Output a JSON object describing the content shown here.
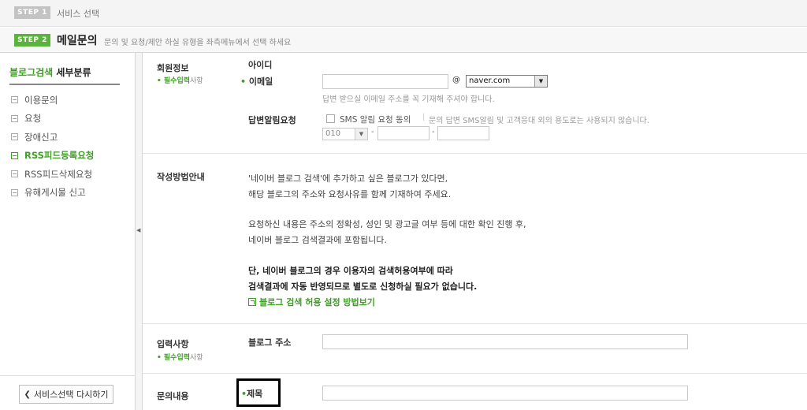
{
  "step1": {
    "badge": "STEP 1",
    "label": "서비스 선택"
  },
  "step2": {
    "badge": "STEP 2",
    "title": "메일문의",
    "desc": "문의 및 요청/제안 하실 유형을 좌측메뉴에서 선택 하세요"
  },
  "sidebar": {
    "heading_green": "블로그검색",
    "heading_black": "세부분류",
    "items": [
      {
        "label": "이용문의",
        "active": false
      },
      {
        "label": "요청",
        "active": false
      },
      {
        "label": "장애신고",
        "active": false
      },
      {
        "label": "RSS피드등록요청",
        "active": true
      },
      {
        "label": "RSS피드삭제요청",
        "active": false
      },
      {
        "label": "유해게시물 신고",
        "active": false
      }
    ],
    "back_button": "서비스선택 다시하기"
  },
  "member": {
    "section_label": "회원정보",
    "required_bold": "필수입력",
    "required_rest": "사항",
    "id_label": "아이디",
    "email_label": "이메일",
    "email_value": "",
    "at": "@",
    "domain": "naver.com",
    "email_hint": "답변 받으실 이메일 주소를 꼭 기재해 주셔야 합니다.",
    "alert_label": "답변알림요청",
    "sms_label": "SMS 알림 요청 동의",
    "sms_sep": "|",
    "sms_note": "문의 답변 SMS알림 및 고객응대 외의 용도로는 사용되지 않습니다.",
    "phone_prefix": "010",
    "phone_dash": "-"
  },
  "guide": {
    "section_label": "작성방법안내",
    "lines": [
      "'네이버 블로그 검색'에 추가하고 싶은 블로그가 있다면,",
      "해당 블로그의 주소와 요청사유를 함께 기재하여 주세요.",
      "요청하신 내용은 주소의 정확성, 성인 및 광고글 여부 등에 대한 확인 진행 후,",
      "네이버 블로그 검색결과에 포함됩니다."
    ],
    "bold_lines": [
      "단, 네이버 블로그의 경우 이용자의 검색허용여부에 따라",
      "검색결과에 자동 반영되므로 별도로 신청하실 필요가 없습니다."
    ],
    "link": "블로그 검색 허용 설정 방법보기"
  },
  "input": {
    "section_label": "입력사항",
    "required_bold": "필수입력",
    "required_rest": "사항",
    "blog_label": "블로그 주소",
    "blog_value": ""
  },
  "inquiry": {
    "section_label": "문의내용",
    "title_label": "제목",
    "title_value": ""
  }
}
